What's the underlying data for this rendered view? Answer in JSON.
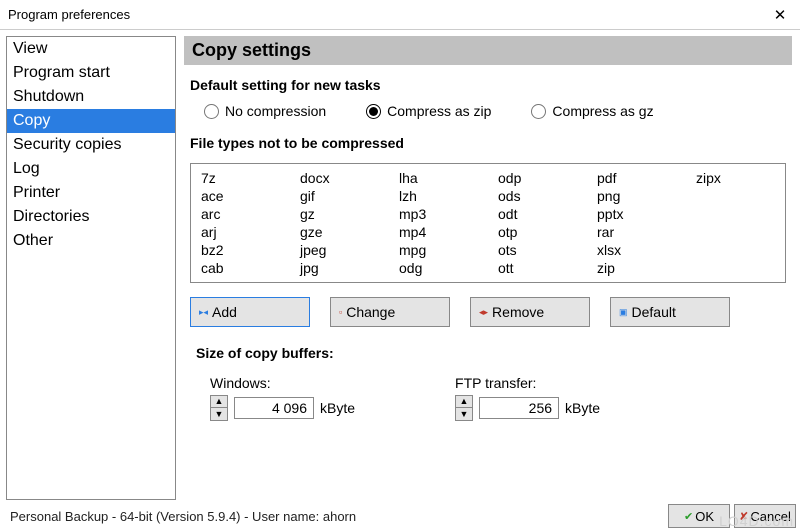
{
  "window": {
    "title": "Program preferences"
  },
  "sidebar": {
    "items": [
      {
        "label": "View"
      },
      {
        "label": "Program start"
      },
      {
        "label": "Shutdown"
      },
      {
        "label": "Copy",
        "selected": true
      },
      {
        "label": "Security copies"
      },
      {
        "label": "Log"
      },
      {
        "label": "Printer"
      },
      {
        "label": "Directories"
      },
      {
        "label": "Other"
      }
    ]
  },
  "section": {
    "title": "Copy settings"
  },
  "default_setting": {
    "heading": "Default setting for new tasks",
    "options": {
      "none": "No compression",
      "zip": "Compress as zip",
      "gz": "Compress as gz"
    },
    "selected": "zip"
  },
  "filetypes": {
    "heading": "File types not to be compressed",
    "ext": [
      "7z",
      "docx",
      "lha",
      "odp",
      "pdf",
      "zipx",
      "ace",
      "gif",
      "lzh",
      "ods",
      "png",
      "",
      "arc",
      "gz",
      "mp3",
      "odt",
      "pptx",
      "",
      "arj",
      "gze",
      "mp4",
      "otp",
      "rar",
      "",
      "bz2",
      "jpeg",
      "mpg",
      "ots",
      "xlsx",
      "",
      "cab",
      "jpg",
      "odg",
      "ott",
      "zip",
      ""
    ],
    "buttons": {
      "add": "Add",
      "change": "Change",
      "remove": "Remove",
      "default": "Default"
    }
  },
  "buffers": {
    "heading": "Size of copy buffers:",
    "windows_label": "Windows:",
    "ftp_label": "FTP transfer:",
    "windows_value": "4 096",
    "ftp_value": "256",
    "unit": "kByte"
  },
  "footer": {
    "status": "Personal Backup - 64-bit (Version 5.9.4) - User name: ahorn",
    "ok": "OK",
    "cancel": "Cancel"
  },
  "watermark": "LO4D.com"
}
